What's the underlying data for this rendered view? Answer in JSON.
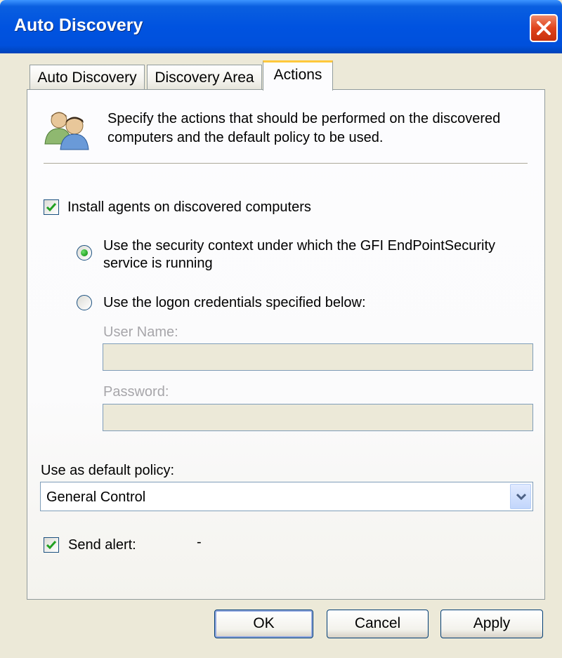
{
  "window": {
    "title": "Auto Discovery"
  },
  "tabs": [
    {
      "label": "Auto Discovery",
      "active": false
    },
    {
      "label": "Discovery Area",
      "active": false
    },
    {
      "label": "Actions",
      "active": true
    }
  ],
  "header": {
    "icon": "users-icon",
    "description_line1": "Specify the actions that should be performed on the discovered",
    "description_line2": "computers and the default policy to be used."
  },
  "install_agents": {
    "label": "Install agents on discovered computers",
    "checked": true
  },
  "security_context_option": {
    "label_line1": "Use the security context under which the GFI EndPointSecurity",
    "label_line2": "service is running",
    "selected": true
  },
  "logon_credentials_option": {
    "label": "Use the logon credentials specified below:",
    "selected": false
  },
  "username": {
    "label": "User Name:",
    "value": ""
  },
  "password": {
    "label": "Password:",
    "value": ""
  },
  "default_policy": {
    "label": "Use as default policy:",
    "value": "General Control"
  },
  "send_alert": {
    "label": "Send alert:",
    "checked": true,
    "extra": "-"
  },
  "buttons": {
    "ok": "OK",
    "cancel": "Cancel",
    "apply": "Apply"
  },
  "colors": {
    "titlebar": "#0053e0",
    "dialog_bg": "#ece9d8",
    "active_tab_accent": "#ffc83c",
    "check_mark": "#21a121"
  }
}
